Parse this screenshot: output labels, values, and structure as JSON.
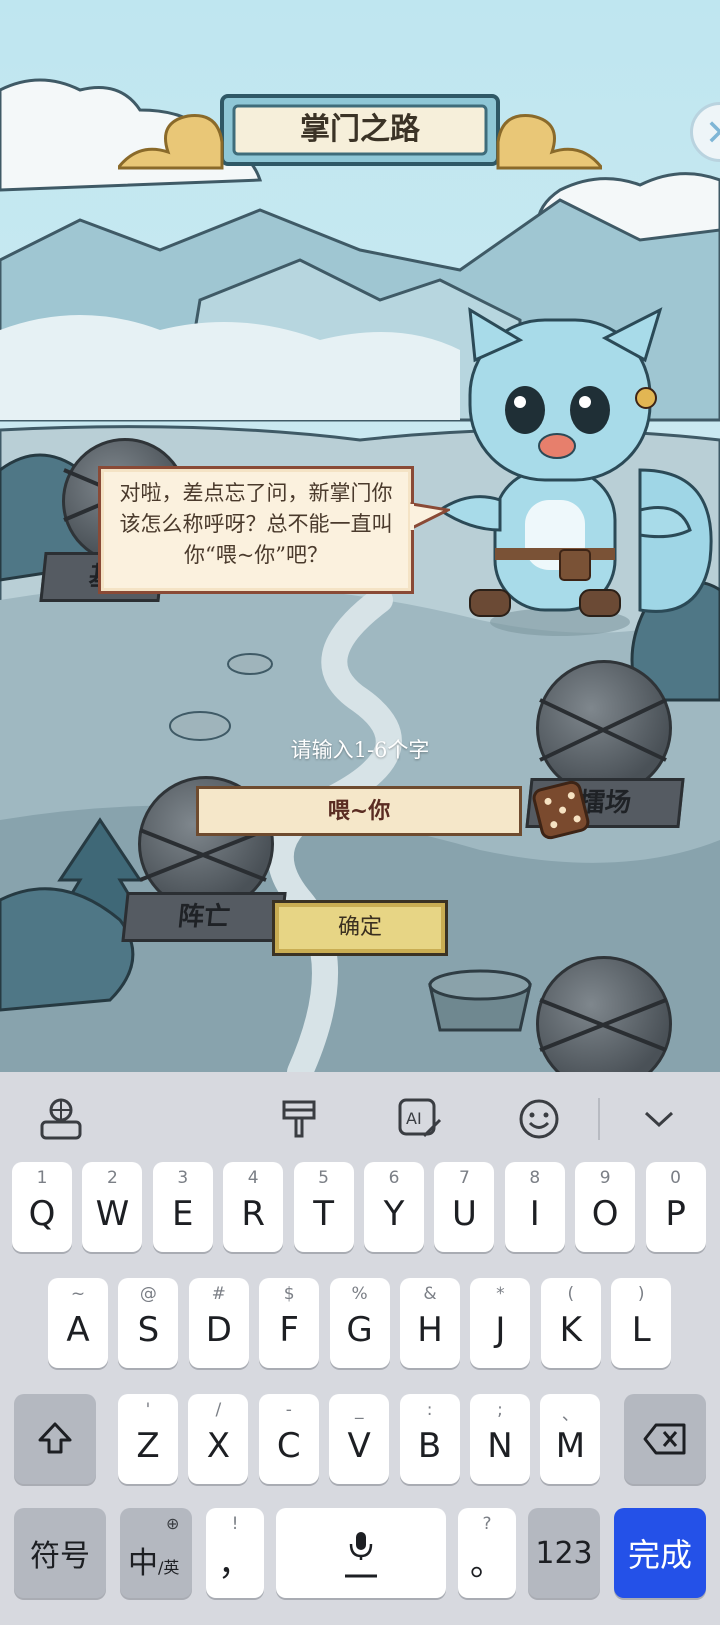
{
  "game": {
    "title": "掌门之路",
    "close_icon": "close-icon",
    "dialog_text": "对啦，差点忘了问，新掌门你该怎么称呼呀？总不能一直叫你“喂~你”吧？",
    "nodes": {
      "left_top_label": "基",
      "mid_left_label": "阵亡",
      "mid_right_label": "擂场"
    },
    "prompt": "请输入1-6个字",
    "name_value": "喂~你",
    "dice_icon": "dice-icon",
    "confirm_label": "确定"
  },
  "keyboard": {
    "toolbar": [
      "keyboard-globe-icon",
      "paint-brush-icon",
      "ai-pen-icon",
      "smiley-icon",
      "chevron-down-icon"
    ],
    "row1": [
      {
        "hint": "1",
        "key": "Q"
      },
      {
        "hint": "2",
        "key": "W"
      },
      {
        "hint": "3",
        "key": "E"
      },
      {
        "hint": "4",
        "key": "R"
      },
      {
        "hint": "5",
        "key": "T"
      },
      {
        "hint": "6",
        "key": "Y"
      },
      {
        "hint": "7",
        "key": "U"
      },
      {
        "hint": "8",
        "key": "I"
      },
      {
        "hint": "9",
        "key": "O"
      },
      {
        "hint": "0",
        "key": "P"
      }
    ],
    "row2": [
      {
        "hint": "~",
        "key": "A"
      },
      {
        "hint": "@",
        "key": "S"
      },
      {
        "hint": "#",
        "key": "D"
      },
      {
        "hint": "$",
        "key": "F"
      },
      {
        "hint": "%",
        "key": "G"
      },
      {
        "hint": "&",
        "key": "H"
      },
      {
        "hint": "*",
        "key": "J"
      },
      {
        "hint": "(",
        "key": "K"
      },
      {
        "hint": ")",
        "key": "L"
      }
    ],
    "row3": [
      {
        "hint": "'",
        "key": "Z"
      },
      {
        "hint": "/",
        "key": "X"
      },
      {
        "hint": "-",
        "key": "C"
      },
      {
        "hint": "_",
        "key": "V"
      },
      {
        "hint": ":",
        "key": "B"
      },
      {
        "hint": ";",
        "key": "N"
      },
      {
        "hint": "、",
        "key": "M"
      }
    ],
    "shift_icon": "shift-icon",
    "backspace_icon": "backspace-icon",
    "symbols_label": "符号",
    "lang_main": "中",
    "lang_sub": "/英",
    "comma_hint": "!",
    "comma_key": "，",
    "space_icon": "microphone-icon",
    "period_hint": "?",
    "period_key": "。",
    "num_label": "123",
    "done_label": "完成"
  }
}
